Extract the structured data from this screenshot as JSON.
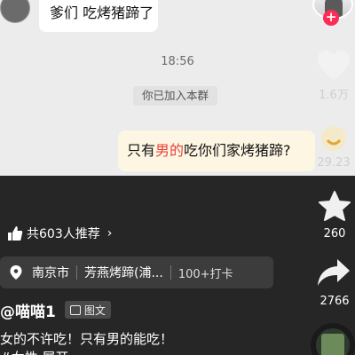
{
  "chat": {
    "top_message": "爹们 吃烤猪蹄了",
    "time": "18:56",
    "joined_notice": "你已加入本群",
    "question_parts": [
      "只有",
      "男的",
      "吃你们家烤猪蹄?"
    ]
  },
  "sidebar": {
    "like_count": "1.6万",
    "gift_count": "29.23",
    "collect_count": "260",
    "share_count": "2766"
  },
  "recommend": {
    "text": "共603人推荐"
  },
  "location": {
    "city": "南京市",
    "shop": "芳燕烤蹄(浦...",
    "checkins": "100+打卡"
  },
  "author": {
    "name": "@喵喵1",
    "tag": "图文"
  },
  "caption": "女的不许吃！只有男的能吃！",
  "hashtag": "#女性 展开",
  "colors": {
    "accent_red": "#fe2c55",
    "bg_dark": "#262626"
  }
}
